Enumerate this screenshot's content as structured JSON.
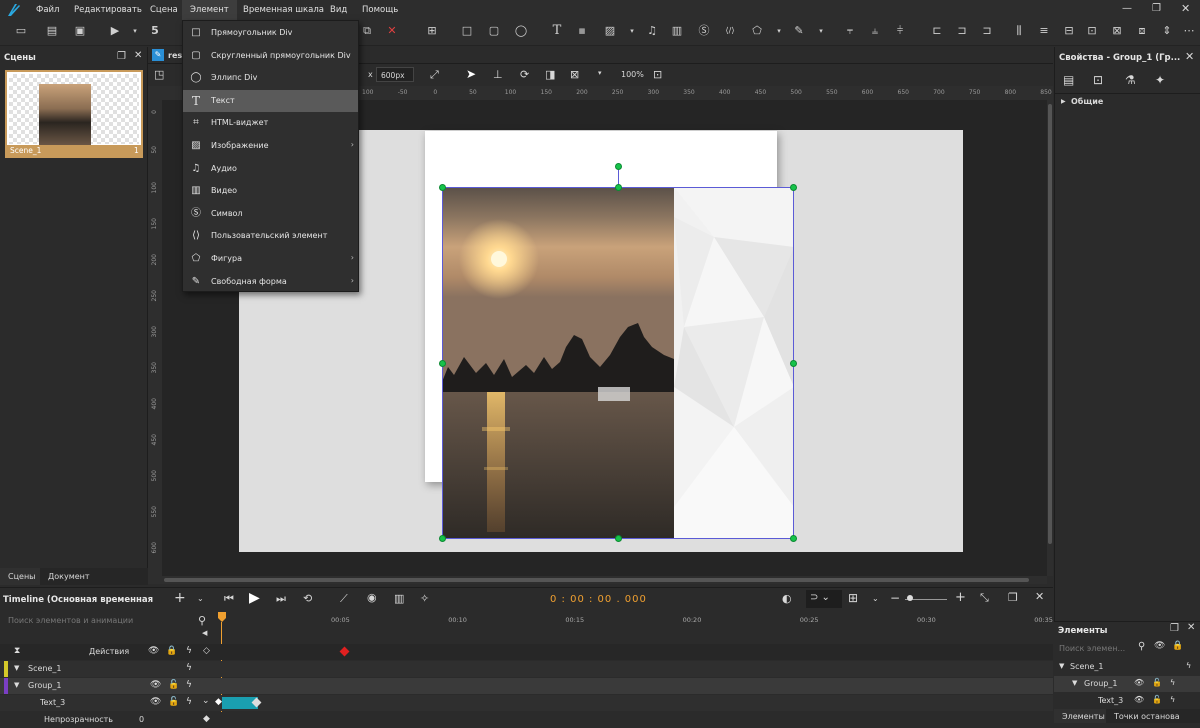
{
  "menu": {
    "items": [
      "Файл",
      "Редактировать",
      "Сцена",
      "Элемент",
      "Временная шкала",
      "Вид",
      "Помощь"
    ]
  },
  "dropdown": {
    "items": [
      {
        "icon": "rect-div-icon",
        "label": "Прямоугольник Div",
        "submenu": false
      },
      {
        "icon": "rounded-rect-div-icon",
        "label": "Скругленный прямоугольник Div",
        "submenu": false
      },
      {
        "icon": "ellipse-div-icon",
        "label": "Эллипс Div",
        "submenu": false
      },
      {
        "icon": "text-icon",
        "label": "Текст",
        "submenu": false,
        "highlighted": true
      },
      {
        "icon": "html-widget-icon",
        "label": "HTML-виджет",
        "submenu": false
      },
      {
        "icon": "image-icon",
        "label": "Изображение",
        "submenu": true
      },
      {
        "icon": "audio-icon",
        "label": "Аудио",
        "submenu": false
      },
      {
        "icon": "video-icon",
        "label": "Видео",
        "submenu": false
      },
      {
        "icon": "symbol-icon",
        "label": "Символ",
        "submenu": false
      },
      {
        "icon": "custom-element-icon",
        "label": "Пользовательский элемент",
        "submenu": false
      },
      {
        "icon": "shape-icon",
        "label": "Фигура",
        "submenu": true
      },
      {
        "icon": "freeform-icon",
        "label": "Свободная форма",
        "submenu": true
      }
    ]
  },
  "scenes": {
    "title": "Сцены",
    "thumb_label": "Scene_1",
    "thumb_num": "1",
    "tabs": [
      "Сцены",
      "Документ"
    ]
  },
  "doc": {
    "tab_label": "resp",
    "width_unit": "x",
    "height_value": "600px",
    "zoom": "100%",
    "ruler_ticks": [
      "100",
      "-50",
      "0",
      "50",
      "100",
      "150",
      "200",
      "250",
      "300",
      "350",
      "400",
      "450",
      "500",
      "550",
      "600",
      "650",
      "700",
      "750",
      "800",
      "850"
    ],
    "vruler_ticks": [
      "0",
      "50",
      "100",
      "150",
      "200",
      "250",
      "300",
      "350",
      "400",
      "450",
      "500",
      "550",
      "600"
    ]
  },
  "properties": {
    "title": "Свойства - Group_1 (Гр...",
    "section": "Общие"
  },
  "timeline": {
    "title": "Timeline (Основная временная шкала",
    "time": "0 : 00 : 00 . 000",
    "search_placeholder": "Поиск элементов и анимации",
    "ticks": [
      "00:05",
      "00:10",
      "00:15",
      "00:20",
      "00:25",
      "00:30",
      "00:35"
    ],
    "rows": [
      {
        "label": "Действия",
        "color": ""
      },
      {
        "label": "Scene_1",
        "color": "#d4c82a"
      },
      {
        "label": "Group_1",
        "color": "#7b3fc4"
      },
      {
        "label": "Text_3",
        "color": ""
      },
      {
        "label": "Непрозрачность",
        "color": ""
      }
    ],
    "opacity_value": "0"
  },
  "elements": {
    "title": "Элементы",
    "search_placeholder": "Поиск элемен...",
    "rows": [
      "Scene_1",
      "Group_1",
      "Text_3"
    ],
    "tabs": [
      "Элементы",
      "Точки останова"
    ]
  },
  "colors": {
    "accent": "#f0a030",
    "selection": "#5b5bd6",
    "handle": "#16c34a",
    "keyframe": "#1a9fb0"
  }
}
